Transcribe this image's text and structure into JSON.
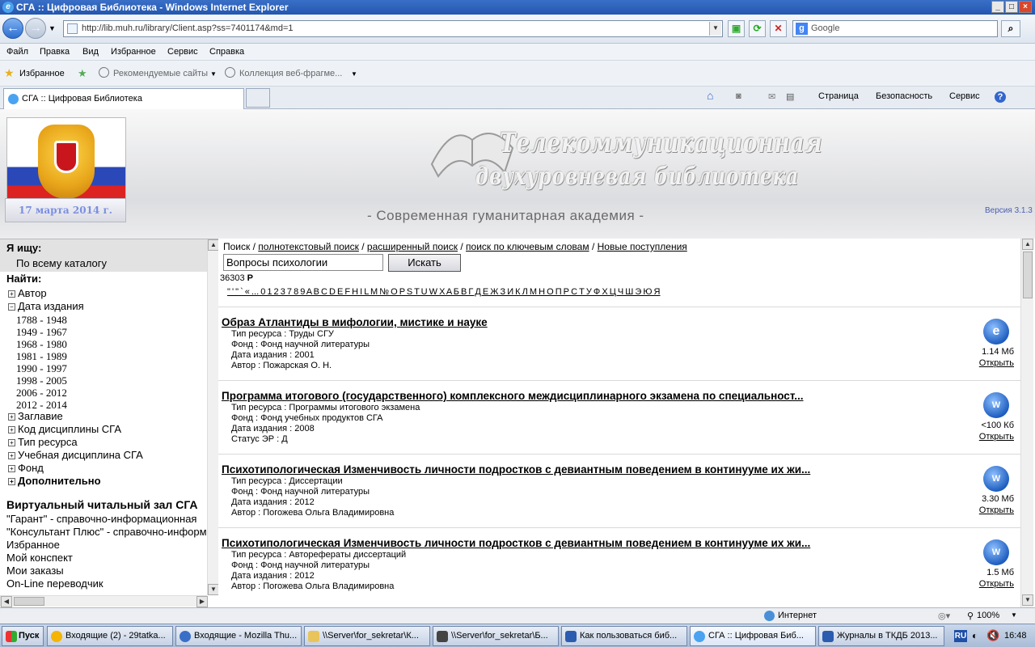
{
  "window": {
    "title": "СГА :: Цифровая Библиотека - Windows Internet Explorer"
  },
  "address": {
    "url": "http://lib.muh.ru/library/Client.asp?ss=7401174&md=1"
  },
  "search_box": {
    "placeholder": "Google"
  },
  "menu": [
    "Файл",
    "Правка",
    "Вид",
    "Избранное",
    "Сервис",
    "Справка"
  ],
  "favbar": {
    "favorites": "Избранное",
    "recommended": "Рекомендуемые сайты",
    "gallery": "Коллекция веб-фрагме..."
  },
  "tab": {
    "title": "СГА :: Цифровая Библиотека"
  },
  "cmdbar": {
    "page": "Страница",
    "safety": "Безопасность",
    "tools": "Сервис"
  },
  "header": {
    "date": "17 марта 2014 г.",
    "lib_line1": "Телекоммуникационная",
    "lib_line2": "двухуровневая библиотека",
    "academy": "- Современная гуманитарная академия -",
    "version": "Версия 3.1.3"
  },
  "sidebar": {
    "looking_for": "Я ищу:",
    "scope": "По всему каталогу",
    "find": "Найти:",
    "author": "Автор",
    "pubdate": "Дата издания",
    "years": [
      "1788 - 1948",
      "1949 - 1967",
      "1968 - 1980",
      "1981 - 1989",
      "1990 - 1997",
      "1998 - 2005",
      "2006 - 2012",
      "2012 - 2014"
    ],
    "title": "Заглавие",
    "code": "Код дисциплины СГА",
    "restype": "Тип ресурса",
    "discipline": "Учебная дисциплина СГА",
    "fund": "Фонд",
    "extra": "Дополнительно",
    "vrr": "Виртуальный читальный зал СГА",
    "links": [
      "\"Гарант\" - справочно-информационная",
      "\"Консультант Плюс\" - справочно-информ",
      "Избранное",
      "Мой конспект",
      "Мои заказы",
      "On-Line переводчик"
    ]
  },
  "main": {
    "crumbs": {
      "search": "Поиск",
      "fulltext": "полнотекстовый поиск",
      "advanced": "расширенный поиск",
      "keywords": "поиск по ключевым словам",
      "new": "Новые поступления",
      "sep": "/"
    },
    "query": "Вопросы психологии",
    "go": "Искать",
    "count": "36303",
    "count_suffix": "Р",
    "alphabet": "\" ' \" ` « ... 0 1 2 3 7 8 9 A B C D E F H I L M № O P S T U W X A Б В Г Д Е Ж З И К Л М Н О П Р С Т У Ф Х Ц Ч Ш Э Ю Я"
  },
  "records": [
    {
      "title": "Образ Атлантиды в мифологии, мистике и науке",
      "lines": [
        "Тип ресурса  :  Труды СГУ",
        "Фонд  :  Фонд научной литературы",
        "Дата издания  :  2001",
        "Автор  :  Пожарская О. Н."
      ],
      "size": "1.14 Мб",
      "open": "Открыть",
      "icon": "ie-icon"
    },
    {
      "title": "Программа итогового (государственного) комплексного междисциплинарного экзамена по специальност...",
      "lines": [
        "Тип ресурса  :  Программы итогового экзамена",
        "Фонд  :  Фонд учебных продуктов СГА",
        "Дата издания  :  2008",
        "Статус ЭР  :  Д"
      ],
      "size": "<100 Кб",
      "open": "Открыть",
      "icon": "word-icon"
    },
    {
      "title": "Психотипологическая Изменчивость личности подростков с девиантным поведением в континууме их жи...",
      "lines": [
        "Тип ресурса  :  Диссертации",
        "Фонд  :  Фонд научной литературы",
        "Дата издания  :  2012",
        "Автор  :  Погожева Ольга Владимировна"
      ],
      "size": "3.30 Мб",
      "open": "Открыть",
      "icon": "word-icon"
    },
    {
      "title": "Психотипологическая Изменчивость личности подростков с девиантным поведением в континууме их жи...",
      "lines": [
        "Тип ресурса  :  Автореферaты диссертаций",
        "Фонд  :  Фонд научной литературы",
        "Дата издания  :  2012",
        "Автор  :  Погожева Ольга Владимировна"
      ],
      "size": "1.5 Мб",
      "open": "Открыть",
      "icon": "word-icon"
    }
  ],
  "status": {
    "zone": "Интернет",
    "zoom": "100%"
  },
  "taskbar": {
    "start": "Пуск",
    "tasks": [
      "Входящие (2) - 29tatka...",
      "Входящие - Mozilla Thu...",
      "\\\\Server\\for_sekretar\\К...",
      "\\\\Server\\for_sekretar\\Б...",
      "Как пользоваться биб...",
      "СГА :: Цифровая Биб...",
      "Журналы в ТКДБ 2013..."
    ],
    "lang": "RU",
    "time": "16:48"
  }
}
